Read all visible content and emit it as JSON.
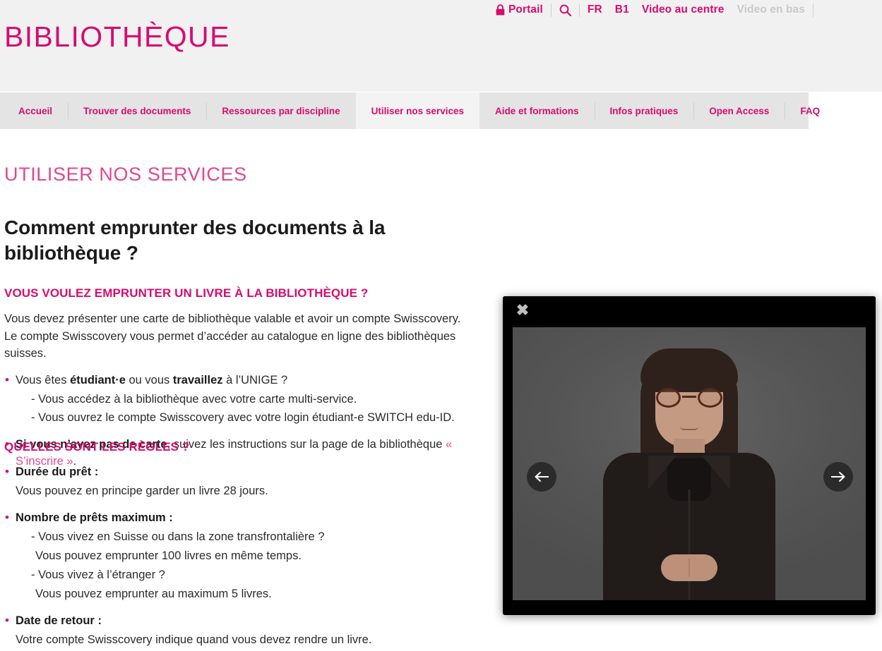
{
  "utility_bar": {
    "items": [
      {
        "label": "Portail",
        "icon": "lock-icon",
        "state": "active"
      },
      {
        "label": "",
        "icon": "search-icon",
        "state": "active"
      },
      {
        "label": "FR",
        "state": "active"
      },
      {
        "label": "B1",
        "state": "active"
      },
      {
        "label": "Video au centre",
        "state": "active"
      },
      {
        "label": "Video en bas",
        "state": "disabled"
      }
    ]
  },
  "brand": {
    "logo_text": "BIBLIOTHÈQUE"
  },
  "nav": {
    "tabs": [
      {
        "label": "Accueil",
        "active": false
      },
      {
        "label": "Trouver des documents",
        "active": false
      },
      {
        "label": "Ressources par discipline",
        "active": false
      },
      {
        "label": "Utiliser nos services",
        "active": true
      },
      {
        "label": "Aide et formations",
        "active": false
      },
      {
        "label": "Infos pratiques",
        "active": false
      },
      {
        "label": "Open Access",
        "active": false
      },
      {
        "label": "FAQ",
        "active": false
      }
    ]
  },
  "main": {
    "eyebrow": "UTILISER NOS SERVICES",
    "title": "Comment emprunter des documents à la bibliothèque ?",
    "section_borrow": {
      "heading": "VOUS VOULEZ EMPRUNTER UN LIVRE À LA BIBLIOTHÈQUE ?",
      "paragraph_1": "Vous devez présenter une carte de bibliothèque valable et avoir un compte Swisscovery.",
      "paragraph_2": "Le compte Swisscovery vous permet d’accéder au catalogue en ligne des bibliothèques suisses.",
      "item_1_pre": "Vous êtes ",
      "item_1_b1": "étudiant·e",
      "item_1_mid": " ou vous ",
      "item_1_b2": "travaillez",
      "item_1_post": " à l’UNIGE ?",
      "item_1_sub_1": "- Vous accédez à la bibliothèque avec votre carte multi-service.",
      "item_1_sub_2": "- Vous ouvrez le compte Swisscovery avec votre login étudiant-e SWITCH edu-ID.",
      "item_2_b": "Si vous n’avez pas de carte",
      "item_2_mid": ", suivez les instructions sur la page de la bibliothèque ",
      "item_2_link": "« S’inscrire »",
      "item_2_end": "."
    },
    "section_rules": {
      "heading": "QUELLES SONT LES RÈGLES ?",
      "rule_1_label": "Durée du prêt :",
      "rule_1_text": "Vous pouvez en principe garder un livre 28 jours.",
      "rule_2_label": "Nombre de prêts maximum :",
      "rule_2_sub_1": "- Vous vivez en Suisse ou dans la zone transfrontalière ?",
      "rule_2_sub_1_text": "Vous pouvez emprunter 100 livres en même temps.",
      "rule_2_sub_2": "- Vous vivez à l’étranger ?",
      "rule_2_sub_2_text": "Vous pouvez emprunter au maximum 5 livres.",
      "rule_3_label": "Date de retour :",
      "rule_3_text": "Votre compte Swisscovery indique quand vous devez rendre un livre."
    }
  },
  "video_panel": {
    "close_label": "✖",
    "prev_label": "←",
    "next_label": "→"
  },
  "colors": {
    "brand_pink": "#d60c6e",
    "light_pink": "#e0478f",
    "header_bg": "#f1f1f1",
    "nav_bg": "#e4e4e4",
    "active_tab_bg": "#f3f3f3",
    "text": "#2b2b2b",
    "disabled": "#c9c9c9",
    "video_bg": "#000000",
    "video_stage": "#5a5a5a"
  }
}
